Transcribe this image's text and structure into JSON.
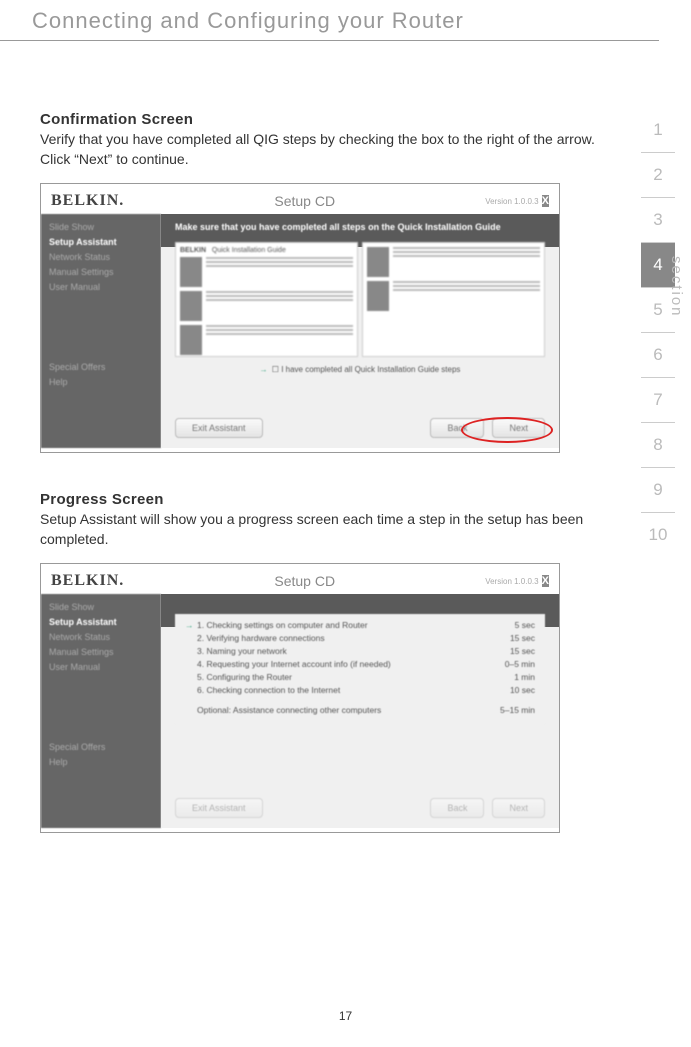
{
  "header": {
    "title": "Connecting and Configuring your Router"
  },
  "sections": {
    "confirmation": {
      "heading": "Confirmation Screen",
      "body": "Verify that you have completed all QIG steps by checking the box to the right of the arrow. Click “Next” to continue."
    },
    "progress": {
      "heading": "Progress Screen",
      "body": "Setup Assistant will show you a progress screen each time a step in the setup has been completed."
    }
  },
  "screenshot": {
    "logo": "BELKIN.",
    "title": "Setup CD",
    "version": "Version 1.0.0.3",
    "close": "X",
    "sidebar": {
      "items": [
        "Slide Show",
        "Setup Assistant",
        "Network Status",
        "Manual Settings",
        "User Manual",
        "Special Offers",
        "Help"
      ],
      "active_index": 1
    },
    "confirm_instruction": "Make sure that you have completed all steps on the Quick Installation Guide",
    "qig_header_left": "BELKIN",
    "qig_header_right": "Quick Installation Guide",
    "confirm_checkbox_label": "I have completed all Quick Installation Guide steps",
    "buttons": {
      "exit": "Exit Assistant",
      "back": "Back",
      "next": "Next"
    },
    "progress_steps": [
      {
        "num": "1",
        "name": "Checking settings on computer and Router",
        "time": "5 sec",
        "active": true
      },
      {
        "num": "2",
        "name": "Verifying hardware connections",
        "time": "15 sec"
      },
      {
        "num": "3",
        "name": "Naming your network",
        "time": "15 sec"
      },
      {
        "num": "4",
        "name": "Requesting your Internet account info (if needed)",
        "time": "0–5 min"
      },
      {
        "num": "5",
        "name": "Configuring the Router",
        "time": "1 min"
      },
      {
        "num": "6",
        "name": "Checking connection to the Internet",
        "time": "10 sec"
      }
    ],
    "optional_step": {
      "name": "Optional: Assistance connecting other computers",
      "time": "5–15 min"
    }
  },
  "nav": {
    "label": "section",
    "items": [
      "1",
      "2",
      "3",
      "4",
      "5",
      "6",
      "7",
      "8",
      "9",
      "10"
    ],
    "active": "4"
  },
  "page_number": "17"
}
